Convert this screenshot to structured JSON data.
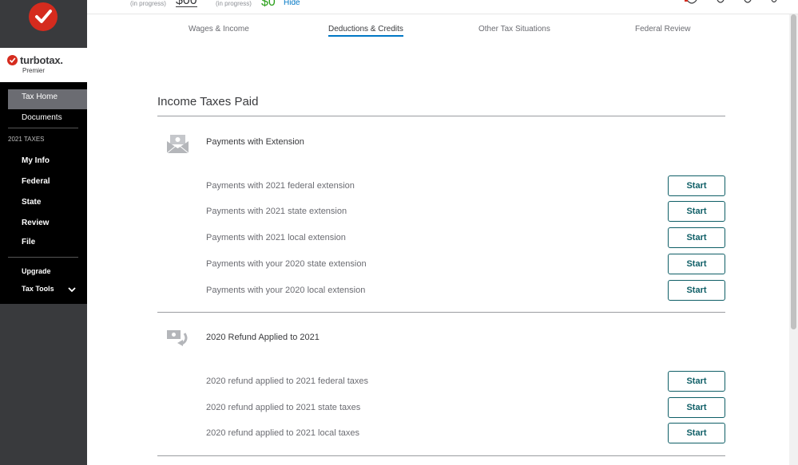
{
  "progress": {
    "federal_label": "(in progress)",
    "federal_value": "$00",
    "state_label": "(in progress)",
    "state_value": "$0",
    "hide_label": "Hide"
  },
  "brand": {
    "name": "turbotax.",
    "edition": "Premier",
    "accent": "#d52b1e"
  },
  "sidebar": {
    "items": [
      {
        "label": "Tax Home"
      },
      {
        "label": "Documents"
      },
      {
        "label": "2021 TAXES"
      },
      {
        "label": "My Info"
      },
      {
        "label": "Federal"
      },
      {
        "label": "State"
      },
      {
        "label": "Review"
      },
      {
        "label": "File"
      },
      {
        "label": "Upgrade"
      },
      {
        "label": "Tax Tools"
      }
    ],
    "active": "Federal"
  },
  "tabs": [
    {
      "label": "Wages & Income"
    },
    {
      "label": "Deductions & Credits"
    },
    {
      "label": "Other Tax Situations"
    },
    {
      "label": "Federal Review"
    }
  ],
  "active_tab": "Deductions & Credits",
  "page": {
    "title": "Income Taxes Paid",
    "sections": [
      {
        "title": "Payments with Extension",
        "icon": "envelope-money-icon",
        "rows": [
          {
            "label": "Payments with 2021 federal extension",
            "button": "Start"
          },
          {
            "label": "Payments with 2021 state extension",
            "button": "Start"
          },
          {
            "label": "Payments with 2021 local extension",
            "button": "Start"
          },
          {
            "label": "Payments with your 2020 state extension",
            "button": "Start"
          },
          {
            "label": "Payments with your 2020 local extension",
            "button": "Start"
          }
        ]
      },
      {
        "title": "2020 Refund Applied to 2021",
        "icon": "refund-arrow-icon",
        "rows": [
          {
            "label": "2020 refund applied to 2021 federal taxes",
            "button": "Start"
          },
          {
            "label": "2020 refund applied to 2021 state taxes",
            "button": "Start"
          },
          {
            "label": "2020 refund applied to 2021 local taxes",
            "button": "Start"
          }
        ]
      }
    ]
  },
  "colors": {
    "primary_button": "#0e5e66",
    "link": "#0077c5",
    "sidebar_bg": "#000000",
    "sidebar_active": "#6b6c72"
  }
}
